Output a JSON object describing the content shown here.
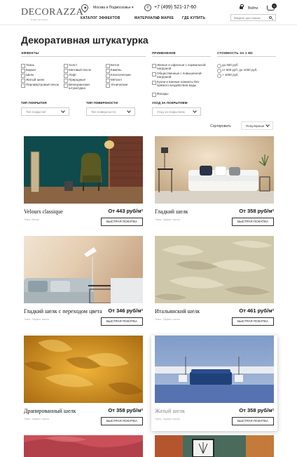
{
  "header": {
    "logo": "DECORAZZA",
    "logo_tagline": "Italian decoration",
    "region": "Москва и Подмосковье",
    "phone": "+7 (499) 521-17-60",
    "login": "Войти",
    "cart_count": "0",
    "search_placeholder": "Введите для поиска...",
    "nav": [
      "КАТАЛОГ ЭФФЕКТОВ",
      "МАТЕРИАЛЫ",
      "О МАРКЕ",
      "ГДЕ КУПИТЬ"
    ]
  },
  "page_title": "Декоративная штукатурка",
  "filters": {
    "effects": {
      "title": "Эффекты",
      "col1": [
        "Ткань",
        "Бархат",
        "Шелк",
        "Жатый шелк",
        "Перламутровый песок"
      ],
      "col2": [
        "Холст",
        "Матовый песок",
        "Лофт",
        "Природные",
        "Венецианская штукатурка"
      ],
      "col3": [
        "Бетон",
        "Камень",
        "Классические",
        "Металл",
        "Этнические"
      ]
    },
    "application": {
      "title": "Применение",
      "items": [
        "Жилые и офисные с нормальной нагрузкой",
        "Общественные с повышенной нагрузкой",
        "Кухни и ванные комнаты без прямого воздействия воды",
        "Фасады"
      ]
    },
    "price": {
      "title": "Стоимость за 1 м2",
      "items": [
        "до 500 руб.",
        "от 500 руб. до 1000 руб.",
        "> 1000 руб."
      ]
    }
  },
  "selects": {
    "coating_type": {
      "label": "Тип покрытия",
      "value": "Тип покрытия"
    },
    "surface_type": {
      "label": "Тип поверхности",
      "value": "Тип поверхности"
    },
    "care_type": {
      "label": "Уход за покрытием",
      "value": "Уход за покрытием"
    }
  },
  "sort": {
    "label": "Сортировать",
    "value": "Популярные"
  },
  "buy_label": "Быстрая покупка",
  "products": [
    {
      "name": "Velours classique",
      "price": "От 443 руб/м²",
      "tags": "Ткань, Велюр"
    },
    {
      "name": "Гладкий шелк",
      "price": "От 358 руб/м²",
      "tags": "Ткань, Эффект шелка"
    },
    {
      "name": "Гладкий шелк с переходом цвета",
      "price": "От 346 руб/м²",
      "tags": "Ткань, Эффект шелка"
    },
    {
      "name": "Итальянский шелк",
      "price": "От 461 руб/м²",
      "tags": "Ткань, Эффект шелка"
    },
    {
      "name": "Драпированный шелк",
      "price": "От 358 руб/м²",
      "tags": "Ткань, Эффект шелка"
    },
    {
      "name": "Жатый шелк",
      "price": "От 358 руб/м²",
      "tags": "Ткань, Эффект шелка"
    }
  ],
  "colors": {
    "accent": "#222222",
    "border": "#cccccc"
  }
}
